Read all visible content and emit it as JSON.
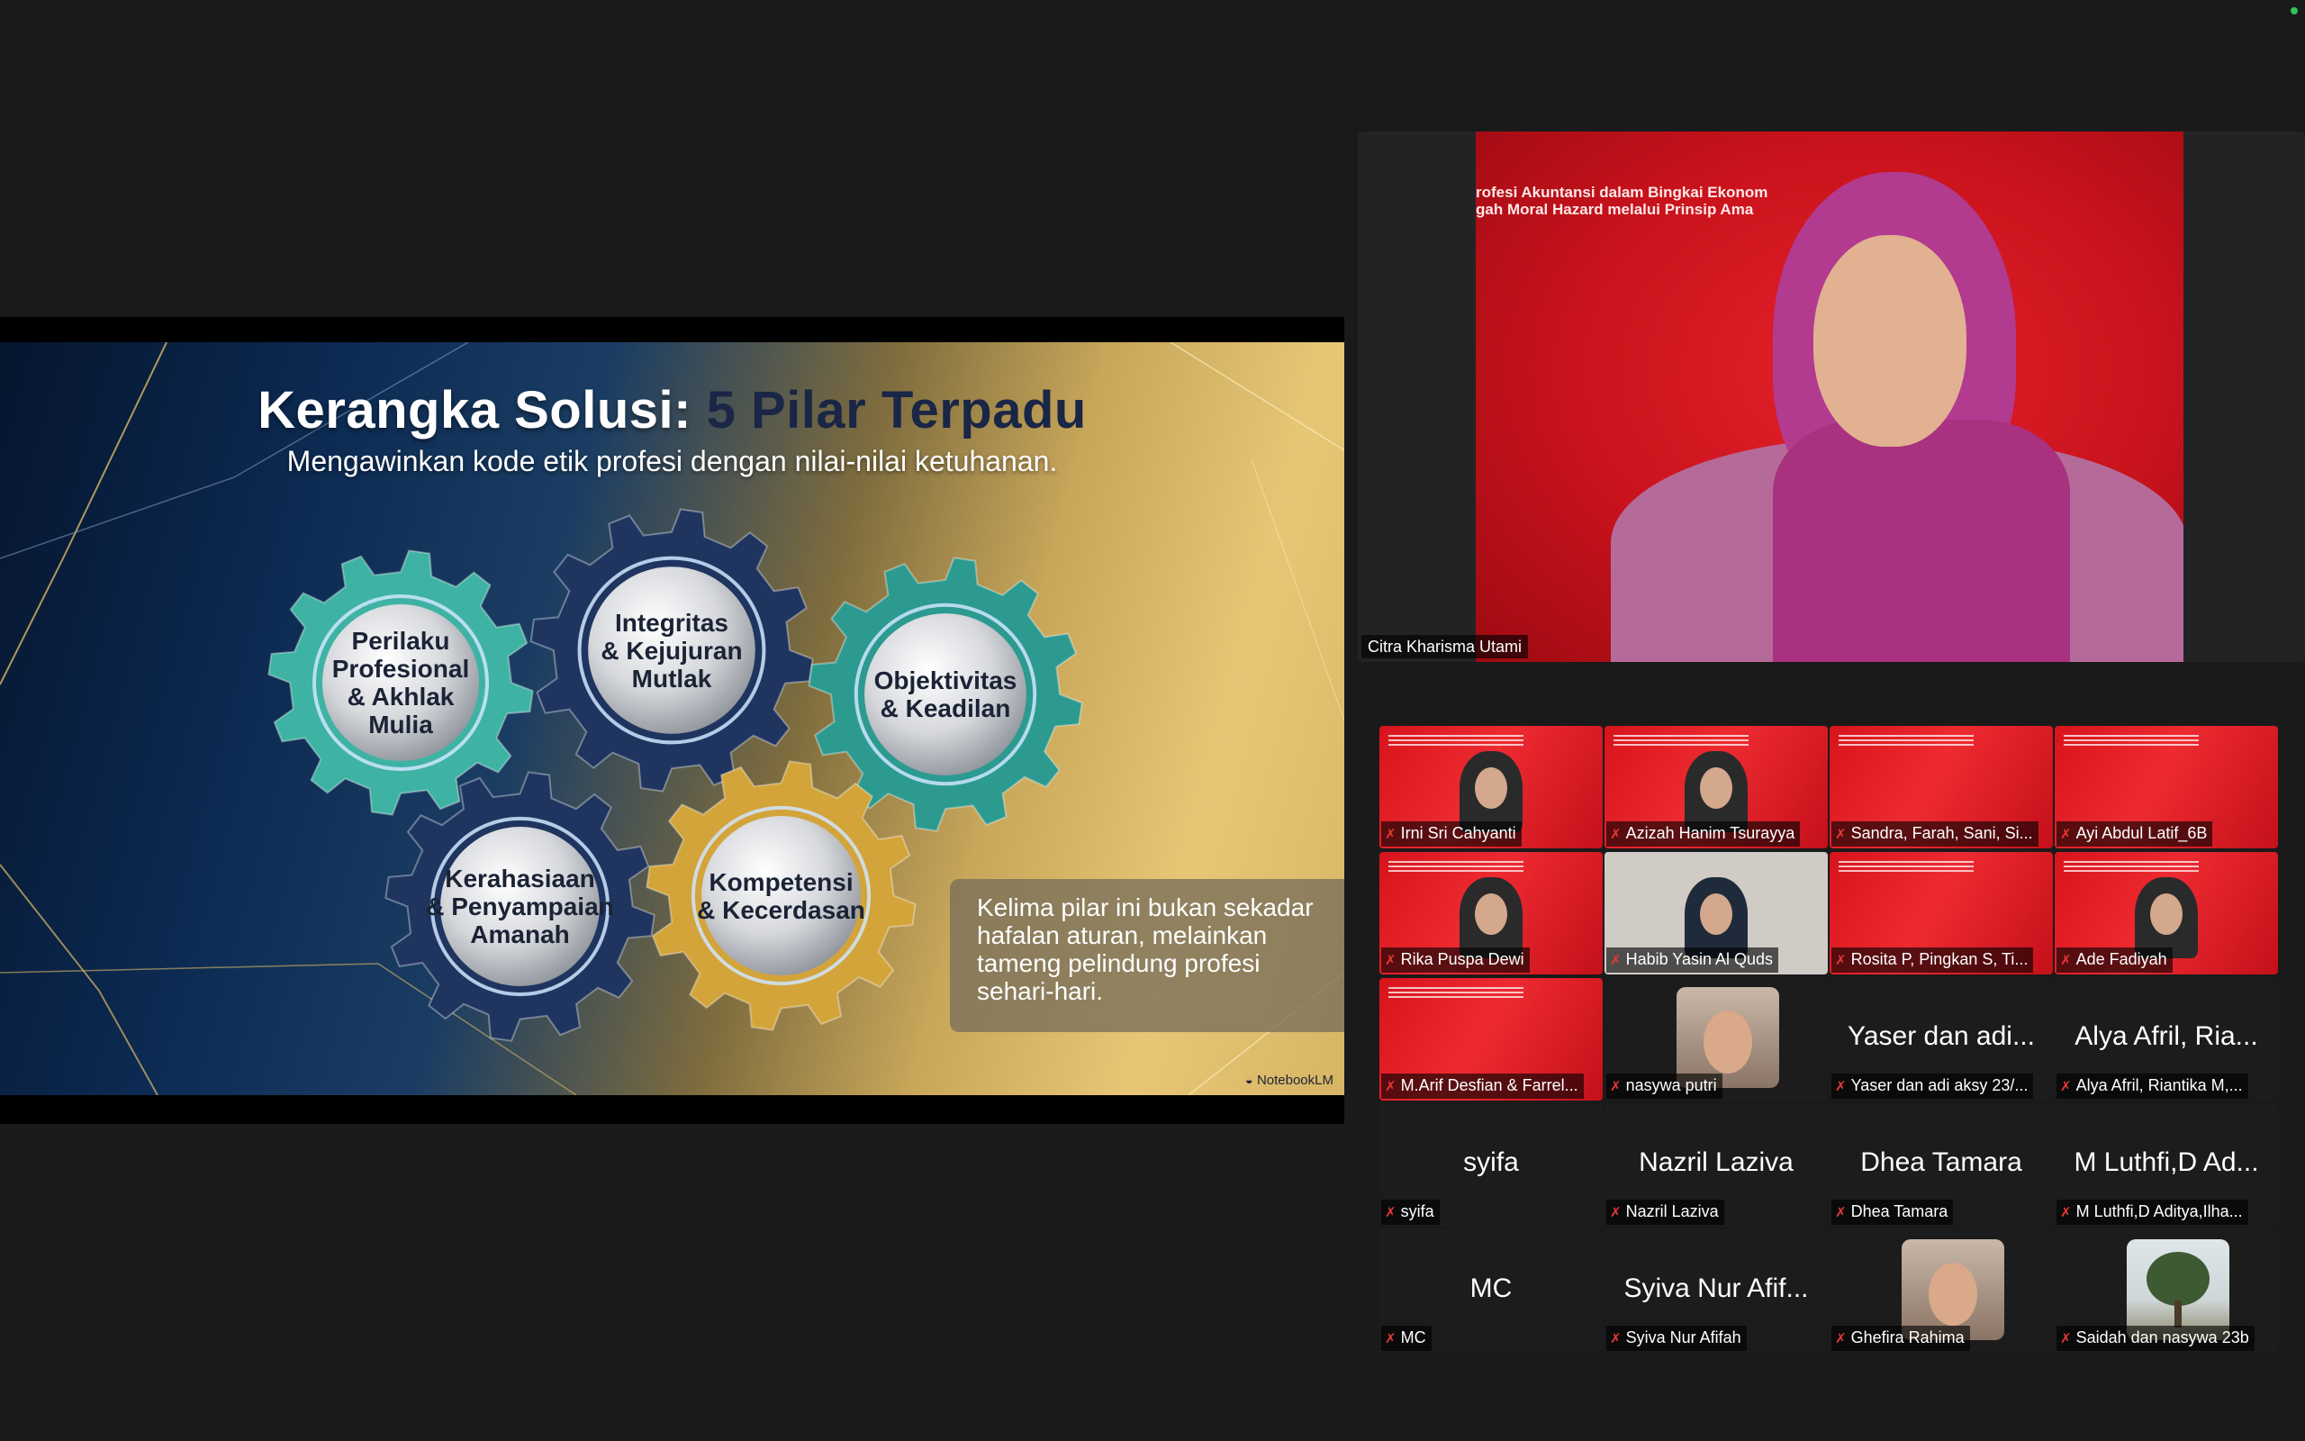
{
  "slide": {
    "title_main": "Kerangka Solusi:",
    "title_accent": "5 Pilar Terpadu",
    "subtitle": "Mengawinkan kode etik profesi dengan nilai-nilai ketuhanan.",
    "gears": [
      {
        "label": "Perilaku\nProfesional\n& Akhlak\nMulia",
        "color": "#3fb3a3"
      },
      {
        "label": "Integritas\n& Kejujuran\nMutlak",
        "color": "#1f3560"
      },
      {
        "label": "Objektivitas\n& Keadilan",
        "color": "#2d9a90"
      },
      {
        "label": "Kerahasiaan\n& Penyampaian\nAmanah",
        "color": "#1f3560"
      },
      {
        "label": "Kompetensi\n& Kecerdasan",
        "color": "#d3a43a"
      }
    ],
    "note": "Kelima pilar ini bukan sekadar hafalan aturan, melainkan tameng pelindung profesi sehari-hari.",
    "watermark": "NotebookLM"
  },
  "speaker": {
    "name": "Citra Kharisma Utami",
    "background_text": "rofesi Akuntansi dalam Bingkai Ekonom\ngah Moral Hazard melalui Prinsip Ama"
  },
  "participants": [
    {
      "name": "Irni Sri Cahyanti",
      "kind": "video-red",
      "person": true
    },
    {
      "name": "Azizah Hanim Tsurayya",
      "kind": "video-red",
      "person": true
    },
    {
      "name": "Sandra, Farah, Sani, Si...",
      "kind": "video-red",
      "person": false
    },
    {
      "name": "Ayi Abdul Latif_6B",
      "kind": "video-red",
      "person": false
    },
    {
      "name": "Rika Puspa Dewi",
      "kind": "video-red",
      "person": true
    },
    {
      "name": "Habib Yasin Al Quds",
      "kind": "video-grey",
      "person": true
    },
    {
      "name": "Rosita P, Pingkan S, Ti...",
      "kind": "video-red",
      "person": false
    },
    {
      "name": "Ade Fadiyah",
      "kind": "video-red",
      "person": true
    },
    {
      "name": "M.Arif Desfian & Farrel...",
      "kind": "video-red",
      "person": false
    },
    {
      "name": "nasywa putri",
      "kind": "photo",
      "big": ""
    },
    {
      "name": "Yaser dan adi aksy 23/...",
      "kind": "name",
      "big": "Yaser dan adi..."
    },
    {
      "name": "Alya Afril, Riantika M,...",
      "kind": "name",
      "big": "Alya Afril, Ria..."
    },
    {
      "name": "syifa",
      "kind": "name",
      "big": "syifa"
    },
    {
      "name": "Nazril Laziva",
      "kind": "name",
      "big": "Nazril Laziva"
    },
    {
      "name": "Dhea Tamara",
      "kind": "name",
      "big": "Dhea Tamara"
    },
    {
      "name": "M Luthfi,D Aditya,Ilha...",
      "kind": "name",
      "big": "M Luthfi,D Ad..."
    },
    {
      "name": "MC",
      "kind": "name",
      "big": "MC"
    },
    {
      "name": "Syiva Nur Afifah",
      "kind": "name",
      "big": "Syiva Nur Afif..."
    },
    {
      "name": "Ghefira Rahima",
      "kind": "photo",
      "big": ""
    },
    {
      "name": "Saidah dan nasywa 23b",
      "kind": "photo-tree",
      "big": ""
    }
  ],
  "colors": {
    "muted_mic": "#e53935",
    "active_status": "#32c25a"
  }
}
